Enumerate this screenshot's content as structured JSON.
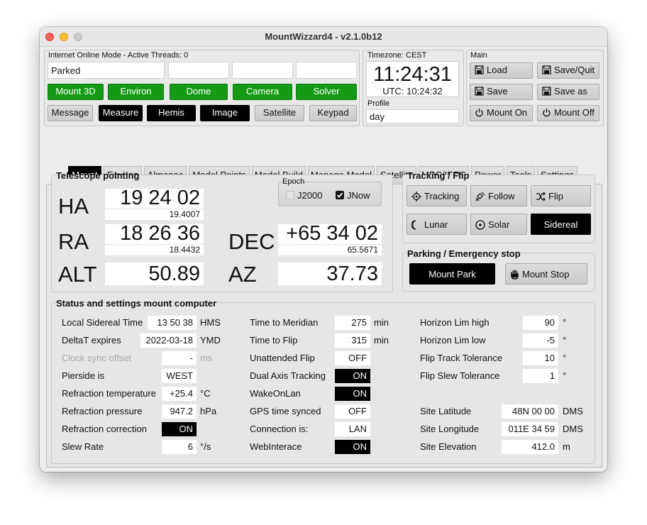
{
  "window": {
    "title": "MountWizzard4 - v2.1.0b12"
  },
  "top": {
    "mode_label": "Internet Online Mode  -  Active Threads: 0",
    "status_fields": [
      "Parked",
      "",
      "",
      "",
      ""
    ],
    "green_buttons": [
      "Mount 3D",
      "Environ",
      "Dome",
      "Camera",
      "Solver"
    ],
    "grey_buttons": [
      "Message",
      "Measure",
      "Hemis",
      "Image",
      "Satellite",
      "Keypad"
    ]
  },
  "time": {
    "tz_label": "Timezone: CEST",
    "local": "11:24:31",
    "utc": "UTC:  10:24:32"
  },
  "profile": {
    "label": "Profile",
    "value": "day"
  },
  "main": {
    "label": "Main",
    "load": "Load",
    "save_quit": "Save/Quit",
    "save": "Save",
    "save_as": "Save as",
    "mount_on": "Mount On",
    "mount_off": "Mount Off"
  },
  "tabs": [
    "Mount",
    "Environ",
    "Almanac",
    "Model Points",
    "Model Build",
    "Manage Model",
    "Satellite",
    "MPC/IERS",
    "Power",
    "Tools",
    "Settings"
  ],
  "pointing": {
    "title": "Telescope pointing",
    "ha_label": "HA",
    "ha": "19 24 02",
    "ha_dec": "19.4007",
    "ra_label": "RA",
    "ra": "18 26 36",
    "ra_dec": "18.4432",
    "dec_label": "DEC",
    "dec": "+65 34 02",
    "dec_dec": "65.5671",
    "alt_label": "ALT",
    "alt": "50.89",
    "az_label": "AZ",
    "az": "37.73",
    "epoch_label": "Epoch",
    "j2000": "J2000",
    "jnow": "JNow"
  },
  "tracking": {
    "title": "Tracking / Flip",
    "tracking": "Tracking",
    "follow": "Follow",
    "flip": "Flip",
    "lunar": "Lunar",
    "solar": "Solar",
    "sidereal": "Sidereal"
  },
  "parking": {
    "title": "Parking / Emergency stop",
    "park": "Mount Park",
    "stop": "Mount Stop"
  },
  "status": {
    "title": "Status and settings mount computer",
    "col1": [
      {
        "label": "Local Sidereal Time",
        "value": "13 50 38",
        "unit": "HMS"
      },
      {
        "label": "DeltaT expires",
        "value": "2022-03-18",
        "unit": "YMD"
      },
      {
        "label": "Clock sync offset",
        "value": "-",
        "unit": "ms"
      },
      {
        "label": "Pierside is",
        "value": "WEST",
        "unit": ""
      },
      {
        "label": "Refraction temperature",
        "value": "+25.4",
        "unit": "°C"
      },
      {
        "label": "Refraction pressure",
        "value": "947.2",
        "unit": "hPa"
      },
      {
        "label": "Refraction correction",
        "value": "ON",
        "unit": ""
      },
      {
        "label": "Slew Rate",
        "value": "6",
        "unit": "°/s"
      }
    ],
    "col2": [
      {
        "label": "Time to Meridian",
        "value": "275",
        "unit": "min"
      },
      {
        "label": "Time to Flip",
        "value": "315",
        "unit": "min"
      },
      {
        "label": "Unattended Flip",
        "value": "OFF",
        "unit": ""
      },
      {
        "label": "Dual Axis Tracking",
        "value": "ON",
        "unit": ""
      },
      {
        "label": "WakeOnLan",
        "value": "ON",
        "unit": ""
      },
      {
        "label": "GPS time synced",
        "value": "OFF",
        "unit": ""
      },
      {
        "label": "Connection is:",
        "value": "LAN",
        "unit": ""
      },
      {
        "label": "WebInterace",
        "value": "ON",
        "unit": ""
      }
    ],
    "col3": [
      {
        "label": "Horizon Lim high",
        "value": "90",
        "unit": "°"
      },
      {
        "label": "Horizon Lim low",
        "value": "-5",
        "unit": "°"
      },
      {
        "label": "Flip Track Tolerance",
        "value": "10",
        "unit": "°"
      },
      {
        "label": "Flip Slew Tolerance",
        "value": "1",
        "unit": "°"
      },
      {
        "label": "Site Latitude",
        "value": "48N 00 00",
        "unit": "DMS"
      },
      {
        "label": "Site Longitude",
        "value": "011E 34 59",
        "unit": "DMS"
      },
      {
        "label": "Site Elevation",
        "value": "412.0",
        "unit": "m"
      }
    ]
  },
  "colors": {
    "green": "#149a14",
    "black": "#000000",
    "close": "#fe5f57",
    "minimize": "#febc2e",
    "zoom": "#c8c8c8"
  }
}
